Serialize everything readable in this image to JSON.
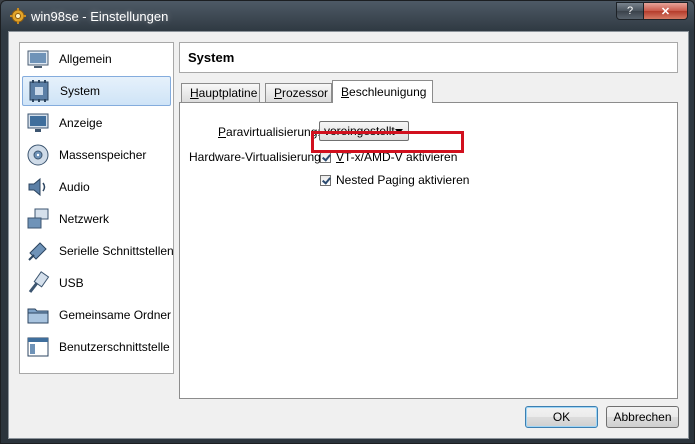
{
  "window": {
    "title": "win98se - Einstellungen",
    "help_label": "?",
    "close_label": "✕"
  },
  "sidebar": {
    "items": [
      {
        "label": "Allgemein",
        "icon": "general-icon",
        "selected": false
      },
      {
        "label": "System",
        "icon": "system-icon",
        "selected": true
      },
      {
        "label": "Anzeige",
        "icon": "display-icon",
        "selected": false
      },
      {
        "label": "Massenspeicher",
        "icon": "storage-icon",
        "selected": false
      },
      {
        "label": "Audio",
        "icon": "audio-icon",
        "selected": false
      },
      {
        "label": "Netzwerk",
        "icon": "network-icon",
        "selected": false
      },
      {
        "label": "Serielle Schnittstellen",
        "icon": "serial-ports-icon",
        "selected": false
      },
      {
        "label": "USB",
        "icon": "usb-icon",
        "selected": false
      },
      {
        "label": "Gemeinsame Ordner",
        "icon": "shared-folders-icon",
        "selected": false
      },
      {
        "label": "Benutzerschnittstelle",
        "icon": "user-interface-icon",
        "selected": false
      }
    ]
  },
  "main": {
    "heading": "System",
    "tabs": [
      {
        "label": "Hauptplatine",
        "mnemonic": "H",
        "rest": "auptplatine",
        "active": false
      },
      {
        "label": "Prozessor",
        "mnemonic": "P",
        "rest": "rozessor",
        "active": false
      },
      {
        "label": "Beschleunigung",
        "mnemonic": "B",
        "rest": "eschleunigung",
        "active": true
      }
    ],
    "paravirt": {
      "label_mnemonic": "P",
      "label_rest": "aravirtualisierung:",
      "value": "voreingestellt"
    },
    "hwvirt": {
      "label": "Hardware-Virtualisierung:",
      "vtx": {
        "mnemonic": "V",
        "rest": "T-x/AMD-V aktivieren",
        "checked": true
      },
      "nested": {
        "before": "Nested Pa",
        "mnemonic": "g",
        "after": "ing aktivieren",
        "checked": true
      }
    }
  },
  "buttons": {
    "ok": "OK",
    "cancel": "Abbrechen"
  },
  "colors": {
    "highlight": "#d1101e",
    "selection_border": "#84acdd"
  }
}
